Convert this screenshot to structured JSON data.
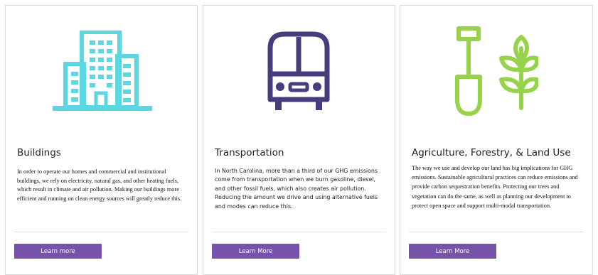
{
  "cards": [
    {
      "title": "Buildings",
      "description": "In order to operate our homes and commercial and institutional buildings, we rely on electricity, natural gas, and other heating fuels, which result in climate and air pollution. Making our buildings more efficient and running on clean energy sources will greatly reduce this.",
      "button_label": "Learn more",
      "icon": "buildings-icon",
      "icon_color": "#5cd6e0"
    },
    {
      "title": "Transportation",
      "description": "In North Carolina, more than a third of our GHG emissions come from transportation when we burn gasoline, diesel, and other fossil fuels, which also creates air pollution. Reducing the amount we drive and using alternative fuels and modes can reduce this.",
      "button_label": "Learn More",
      "icon": "bus-icon",
      "icon_color": "#453d7c"
    },
    {
      "title": "Agriculture, Forestry, & Land Use",
      "description": "The way we use and develop our land has big implications for GHG emissions. Sustainable agricultural practices can reduce emissions and provide carbon sequestration benefits. Protecting our trees and vegetation can do the same, as well as planning our development to protect open space and support multi-modal transportation.",
      "button_label": "Learn More",
      "icon": "shovel-plant-icon",
      "icon_color": "#96d24a"
    }
  ],
  "colors": {
    "button_bg": "#7652a8",
    "border": "#d9d9d9"
  }
}
